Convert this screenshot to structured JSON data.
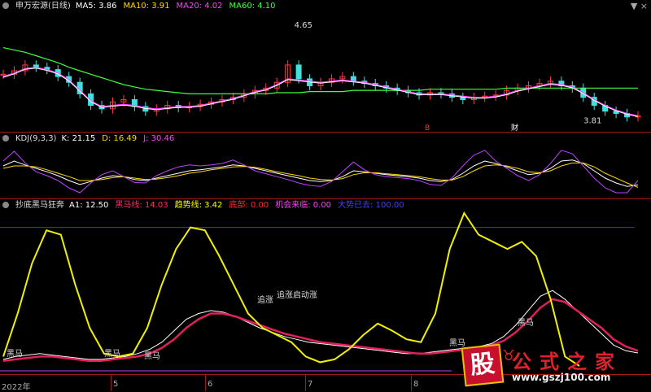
{
  "window_controls": "▼ ×",
  "panel1": {
    "title": "申万宏源(日线)",
    "legend": [
      {
        "label": "MA5: 3.86",
        "color": "#ffffff"
      },
      {
        "label": "MA10: 3.91",
        "color": "#ffd800"
      },
      {
        "label": "MA20: 4.02",
        "color": "#ff40ff"
      },
      {
        "label": "MA60: 4.10",
        "color": "#40ff40"
      }
    ],
    "high_label": "4.65",
    "low_label": "3.81",
    "event_marks": [
      "B",
      "财"
    ]
  },
  "panel2": {
    "title": "KDJ(9,3,3)",
    "legend": [
      {
        "label": "K: 21.15",
        "color": "#ffffff"
      },
      {
        "label": "D: 16.49",
        "color": "#ffd800"
      },
      {
        "label": "J: 30.46",
        "color": "#ff40ff"
      }
    ]
  },
  "panel3": {
    "title": "抄底黑马狂奔",
    "legend": [
      {
        "label": "A1: 12.50",
        "color": "#ffffff"
      },
      {
        "label": "黑马线: 14.03",
        "color": "#ff3060"
      },
      {
        "label": "趋势线: 3.42",
        "color": "#ffff00"
      },
      {
        "label": "底部: 0.00",
        "color": "#ff3030"
      },
      {
        "label": "机会来临: 0.00",
        "color": "#ff40ff"
      },
      {
        "label": "大势已去: 100.00",
        "color": "#4040ff"
      }
    ],
    "annotations": [
      "黑马",
      "黑马",
      "黑马",
      "追涨",
      "追涨启动涨",
      "黑马",
      "黑马"
    ]
  },
  "x_axis": [
    "2022年",
    "5",
    "6",
    "7",
    "8"
  ],
  "logo": {
    "badge": "股",
    "name": "公式之家",
    "url": "www.gszj100.com"
  },
  "chart_data": [
    {
      "type": "candlestick",
      "title": "申万宏源(日线)",
      "close": [
        4.22,
        4.25,
        4.3,
        4.28,
        4.26,
        4.2,
        4.15,
        4.05,
        3.95,
        3.92,
        3.98,
        4.0,
        3.94,
        3.9,
        3.92,
        3.95,
        3.93,
        3.94,
        3.96,
        3.98,
        4.0,
        4.02,
        4.05,
        4.08,
        4.1,
        4.15,
        4.3,
        4.18,
        4.12,
        4.15,
        4.18,
        4.2,
        4.16,
        4.14,
        4.12,
        4.1,
        4.08,
        4.06,
        4.04,
        4.06,
        4.05,
        4.02,
        4.0,
        4.02,
        4.03,
        4.04,
        4.08,
        4.1,
        4.12,
        4.14,
        4.16,
        4.12,
        4.1,
        4.02,
        3.95,
        3.9,
        3.88,
        3.85,
        3.86
      ],
      "ma5": [
        4.2,
        4.23,
        4.27,
        4.28,
        4.26,
        4.23,
        4.17,
        4.08,
        3.99,
        3.94,
        3.95,
        3.96,
        3.95,
        3.93,
        3.92,
        3.93,
        3.94,
        3.94,
        3.95,
        3.97,
        3.99,
        4.01,
        4.04,
        4.07,
        4.09,
        4.13,
        4.18,
        4.17,
        4.16,
        4.15,
        4.16,
        4.17,
        4.16,
        4.15,
        4.13,
        4.11,
        4.09,
        4.07,
        4.05,
        4.05,
        4.05,
        4.04,
        4.03,
        4.02,
        4.02,
        4.03,
        4.05,
        4.08,
        4.1,
        4.12,
        4.14,
        4.13,
        4.11,
        4.06,
        4.0,
        3.95,
        3.91,
        3.88,
        3.86
      ],
      "ma60": [
        4.45,
        4.43,
        4.41,
        4.38,
        4.35,
        4.32,
        4.28,
        4.25,
        4.22,
        4.19,
        4.16,
        4.13,
        4.11,
        4.09,
        4.08,
        4.07,
        4.06,
        4.05,
        4.05,
        4.05,
        4.05,
        4.05,
        4.05,
        4.05,
        4.05,
        4.06,
        4.06,
        4.06,
        4.07,
        4.07,
        4.07,
        4.07,
        4.08,
        4.08,
        4.08,
        4.08,
        4.08,
        4.08,
        4.08,
        4.09,
        4.09,
        4.09,
        4.09,
        4.09,
        4.09,
        4.09,
        4.1,
        4.1,
        4.1,
        4.1,
        4.1,
        4.1,
        4.1,
        4.1,
        4.1,
        4.1,
        4.1,
        4.1,
        4.1
      ],
      "ylim": [
        3.75,
        4.75
      ]
    },
    {
      "type": "line",
      "title": "KDJ(9,3,3)",
      "series": [
        {
          "name": "K",
          "values": [
            60,
            70,
            62,
            55,
            48,
            40,
            30,
            22,
            28,
            35,
            40,
            38,
            32,
            30,
            35,
            40,
            45,
            50,
            52,
            55,
            58,
            62,
            60,
            55,
            50,
            45,
            40,
            35,
            30,
            28,
            30,
            38,
            50,
            48,
            45,
            42,
            40,
            38,
            35,
            30,
            28,
            32,
            45,
            60,
            70,
            65,
            58,
            50,
            42,
            45,
            55,
            70,
            72,
            65,
            50,
            35,
            25,
            18,
            21
          ]
        },
        {
          "name": "D",
          "values": [
            55,
            60,
            60,
            58,
            52,
            45,
            38,
            30,
            30,
            32,
            36,
            38,
            35,
            32,
            33,
            36,
            40,
            45,
            48,
            52,
            55,
            58,
            59,
            57,
            53,
            48,
            44,
            40,
            35,
            32,
            31,
            34,
            42,
            46,
            46,
            44,
            42,
            40,
            38,
            34,
            31,
            31,
            38,
            50,
            60,
            62,
            60,
            55,
            48,
            46,
            50,
            60,
            66,
            66,
            58,
            45,
            35,
            25,
            16
          ]
        },
        {
          "name": "J",
          "values": [
            70,
            90,
            66,
            48,
            40,
            30,
            15,
            5,
            25,
            42,
            50,
            38,
            26,
            25,
            40,
            50,
            58,
            62,
            60,
            62,
            65,
            72,
            62,
            50,
            44,
            38,
            32,
            25,
            20,
            18,
            28,
            48,
            68,
            52,
            42,
            38,
            36,
            34,
            30,
            22,
            20,
            35,
            60,
            82,
            92,
            70,
            55,
            40,
            30,
            42,
            65,
            92,
            85,
            60,
            35,
            15,
            5,
            5,
            30
          ]
        }
      ],
      "ylim": [
        0,
        100
      ]
    },
    {
      "type": "line",
      "title": "抄底黑马狂奔",
      "series": [
        {
          "name": "A1",
          "values": [
            8,
            10,
            11,
            12,
            11,
            10,
            9,
            8,
            8,
            9,
            10,
            12,
            15,
            20,
            28,
            36,
            40,
            42,
            41,
            38,
            34,
            30,
            27,
            24,
            22,
            20,
            19,
            18,
            17,
            16,
            15,
            14,
            13,
            12,
            12,
            13,
            14,
            15,
            16,
            17,
            19,
            24,
            32,
            42,
            52,
            56,
            50,
            42,
            34,
            26,
            18,
            14,
            12.5
          ]
        },
        {
          "name": "黑马线",
          "values": [
            7,
            8,
            9,
            10,
            10,
            9,
            8,
            7,
            7,
            8,
            9,
            10,
            12,
            16,
            22,
            30,
            36,
            40,
            40,
            38,
            35,
            32,
            29,
            26,
            24,
            22,
            20,
            19,
            18,
            17,
            16,
            15,
            14,
            13,
            12,
            12,
            13,
            14,
            15,
            16,
            18,
            21,
            27,
            35,
            44,
            50,
            48,
            42,
            36,
            30,
            22,
            17,
            14.03
          ]
        },
        {
          "name": "趋势线",
          "values": [
            10,
            40,
            75,
            98,
            95,
            60,
            30,
            12,
            10,
            12,
            30,
            60,
            85,
            100,
            98,
            80,
            60,
            40,
            30,
            25,
            20,
            10,
            6,
            8,
            15,
            25,
            33,
            28,
            22,
            20,
            40,
            85,
            110,
            95,
            90,
            85,
            90,
            80,
            50,
            10,
            3.42
          ]
        },
        {
          "name": "大势已去",
          "values": [
            100
          ]
        },
        {
          "name": "底部",
          "values": [
            0
          ]
        },
        {
          "name": "机会来临",
          "values": [
            0
          ]
        }
      ],
      "ylim": [
        0,
        110
      ]
    }
  ]
}
